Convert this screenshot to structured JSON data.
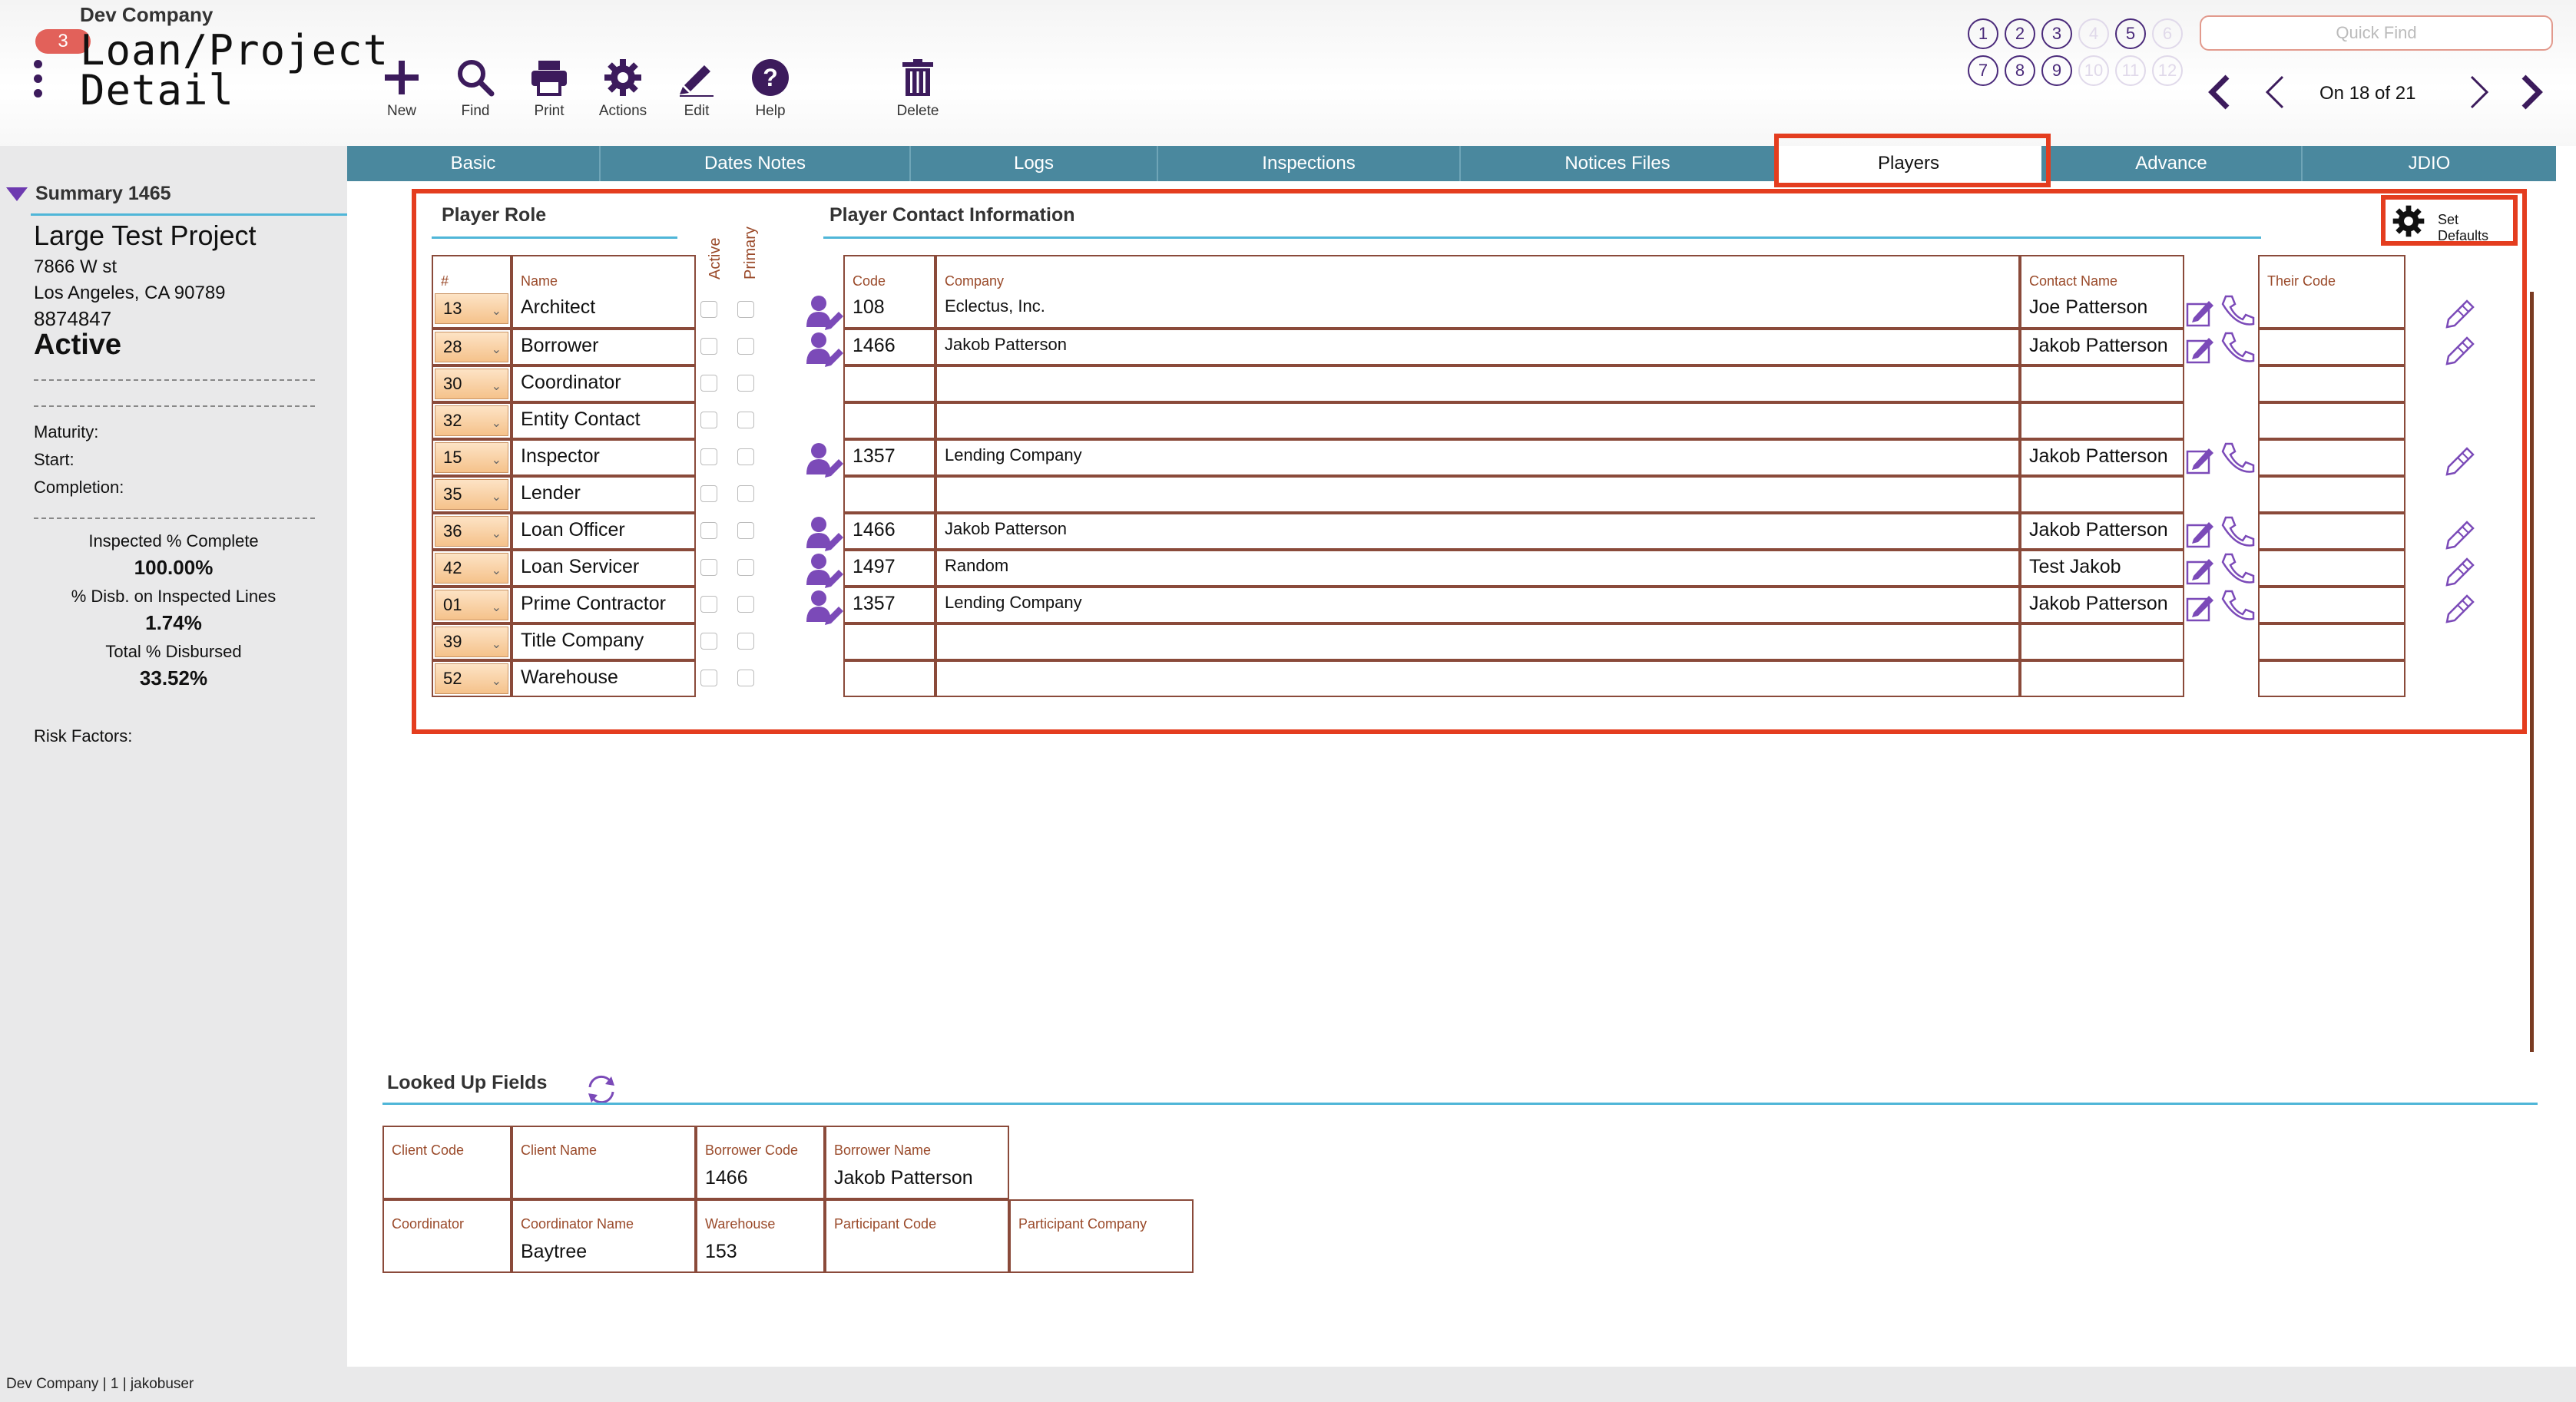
{
  "header": {
    "company": "Dev Company",
    "notification_count": "3",
    "title_line1": "Loan/Project",
    "title_line2": "Detail",
    "toolbar": {
      "new": "New",
      "find": "Find",
      "print": "Print",
      "actions": "Actions",
      "edit": "Edit",
      "help": "Help",
      "delete": "Delete"
    },
    "nav_circles": [
      "1",
      "2",
      "3",
      "4",
      "5",
      "6",
      "7",
      "8",
      "9",
      "10",
      "11",
      "12"
    ],
    "quick_find_placeholder": "Quick Find",
    "pager": "On 18 of 21"
  },
  "sidebar": {
    "summary_label": "Summary 1465",
    "project_name": "Large Test Project",
    "address1": "7866 W st",
    "address2": "Los Angeles, CA  90789",
    "number": "8874847",
    "status": "Active",
    "maturity_label": "Maturity:",
    "start_label": "Start:",
    "completion_label": "Completion:",
    "inspected_label": "Inspected % Complete",
    "inspected_value": "100.00%",
    "disb_label": "% Disb. on Inspected Lines",
    "disb_value": "1.74%",
    "total_label": "Total % Disbursed",
    "total_value": "33.52%",
    "risk_label": "Risk Factors:"
  },
  "tabs": [
    "Basic",
    "Dates Notes",
    "Logs",
    "Inspections",
    "Notices Files",
    "Players",
    "Advance",
    "JDIO"
  ],
  "players": {
    "role_title": "Player Role",
    "contact_title": "Player Contact Information",
    "set_defaults": "Set Defaults",
    "col_num": "#",
    "col_name": "Name",
    "col_active": "Active",
    "col_primary": "Primary",
    "col_code": "Code",
    "col_company": "Company",
    "col_contact": "Contact Name",
    "col_their_code": "Their Code",
    "rows": [
      {
        "num": "13",
        "name": "Architect",
        "code": "108",
        "company": "Eclectus, Inc.",
        "contact": "Joe Patterson",
        "their_code": ""
      },
      {
        "num": "28",
        "name": "Borrower",
        "code": "1466",
        "company": "Jakob Patterson",
        "contact": "Jakob Patterson",
        "their_code": ""
      },
      {
        "num": "30",
        "name": "Coordinator",
        "code": "",
        "company": "",
        "contact": "",
        "their_code": ""
      },
      {
        "num": "32",
        "name": "Entity Contact",
        "code": "",
        "company": "",
        "contact": "",
        "their_code": ""
      },
      {
        "num": "15",
        "name": "Inspector",
        "code": "1357",
        "company": "Lending Company",
        "contact": "Jakob Patterson",
        "their_code": ""
      },
      {
        "num": "35",
        "name": "Lender",
        "code": "",
        "company": "",
        "contact": "",
        "their_code": ""
      },
      {
        "num": "36",
        "name": "Loan Officer",
        "code": "1466",
        "company": "Jakob Patterson",
        "contact": "Jakob Patterson",
        "their_code": ""
      },
      {
        "num": "42",
        "name": "Loan Servicer",
        "code": "1497",
        "company": "Random",
        "contact": "Test Jakob",
        "their_code": ""
      },
      {
        "num": "01",
        "name": "Prime Contractor",
        "code": "1357",
        "company": "Lending Company",
        "contact": "Jakob Patterson",
        "their_code": ""
      },
      {
        "num": "39",
        "name": "Title Company",
        "code": "",
        "company": "",
        "contact": "",
        "their_code": ""
      },
      {
        "num": "52",
        "name": "Warehouse",
        "code": "",
        "company": "",
        "contact": "",
        "their_code": ""
      }
    ]
  },
  "looked_up": {
    "title": "Looked Up Fields",
    "fields": {
      "client_code": {
        "label": "Client Code",
        "value": ""
      },
      "client_name": {
        "label": "Client Name",
        "value": ""
      },
      "borrower_code": {
        "label": "Borrower Code",
        "value": "1466"
      },
      "borrower_name": {
        "label": "Borrower Name",
        "value": "Jakob Patterson"
      },
      "coordinator": {
        "label": "Coordinator",
        "value": ""
      },
      "coordinator_name": {
        "label": "Coordinator Name",
        "value": "Baytree"
      },
      "warehouse": {
        "label": "Warehouse",
        "value": "153"
      },
      "participant_code": {
        "label": "Participant Code",
        "value": ""
      },
      "participant_company": {
        "label": "Participant Company",
        "value": ""
      }
    }
  },
  "footer": "Dev Company | 1 | jakobuser"
}
